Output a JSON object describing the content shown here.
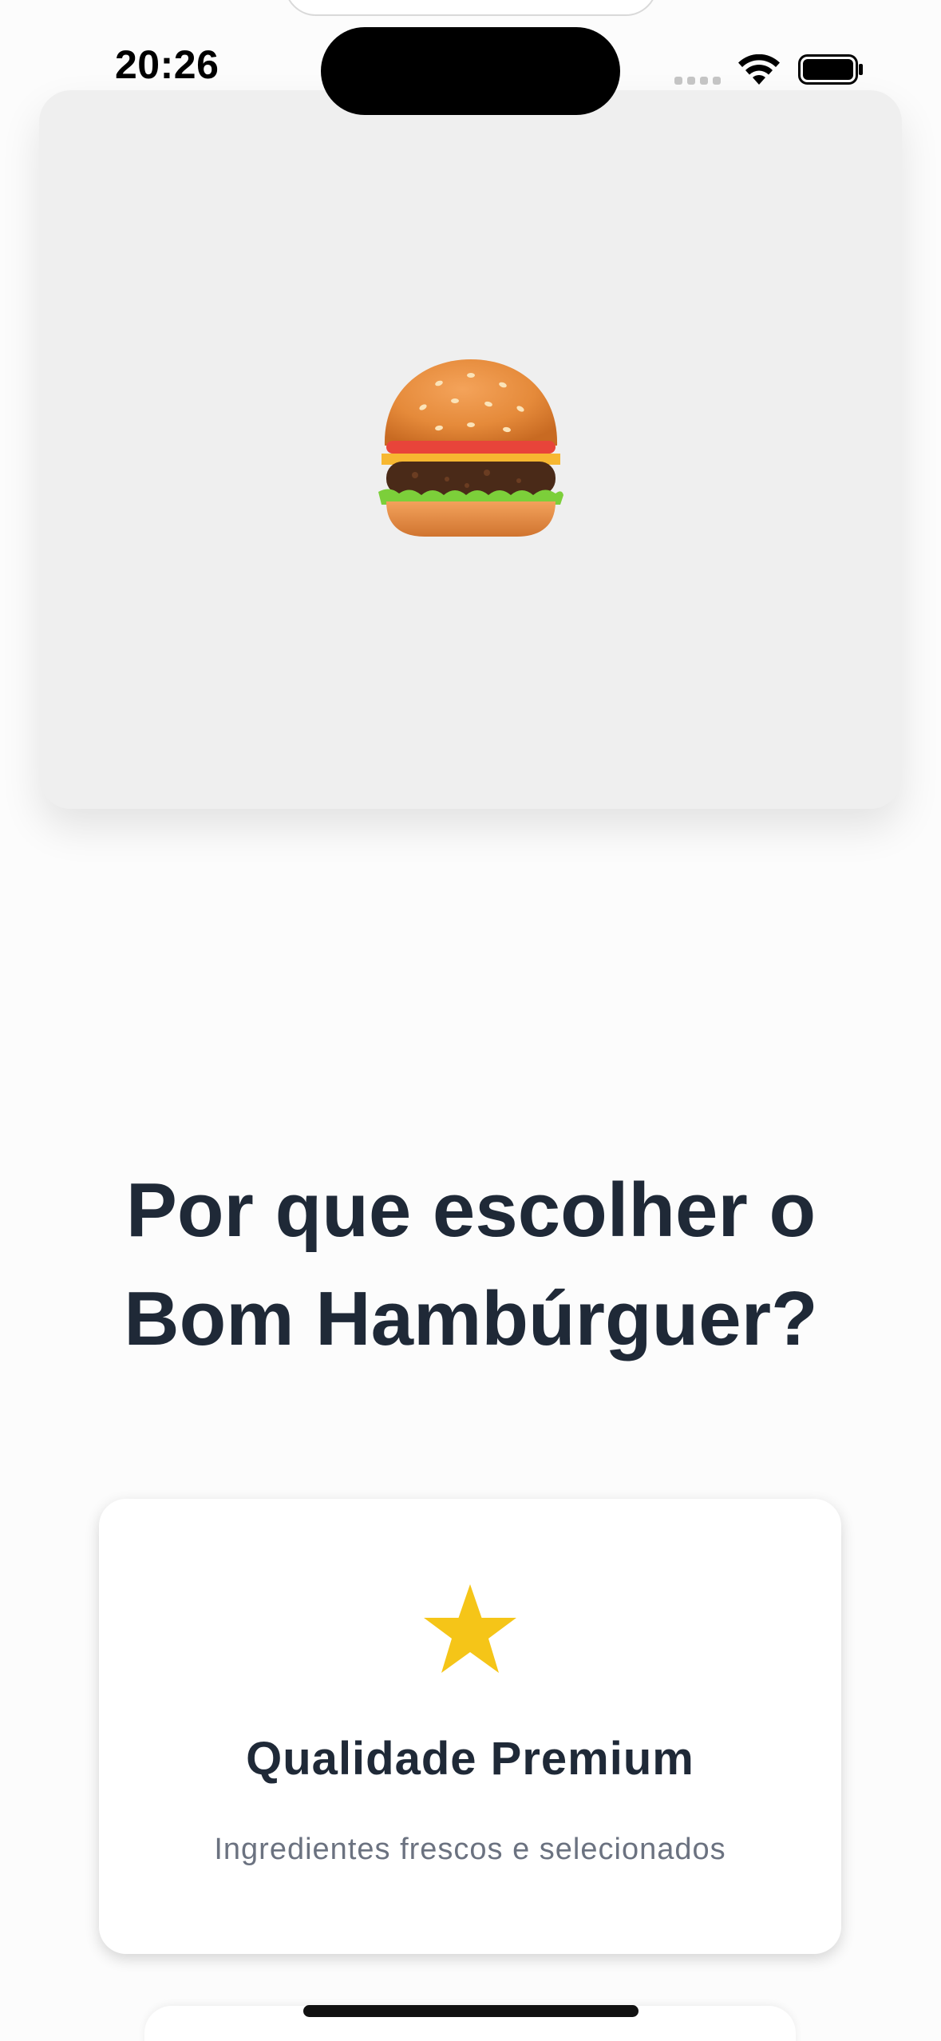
{
  "status_bar": {
    "time": "20:26"
  },
  "hero": {
    "image_icon": "hamburger-emoji",
    "background_color": "#efefef"
  },
  "section": {
    "title_line1": "Por que escolher o",
    "title_line2": "Bom Hambúrguer?"
  },
  "features": [
    {
      "icon": "star-icon",
      "icon_color": "#f5c518",
      "title": "Qualidade Premium",
      "description": "Ingredientes frescos e selecionados"
    }
  ],
  "colors": {
    "heading": "#1f2937",
    "muted_text": "#6b7280",
    "page_background": "#fcfcfc"
  }
}
